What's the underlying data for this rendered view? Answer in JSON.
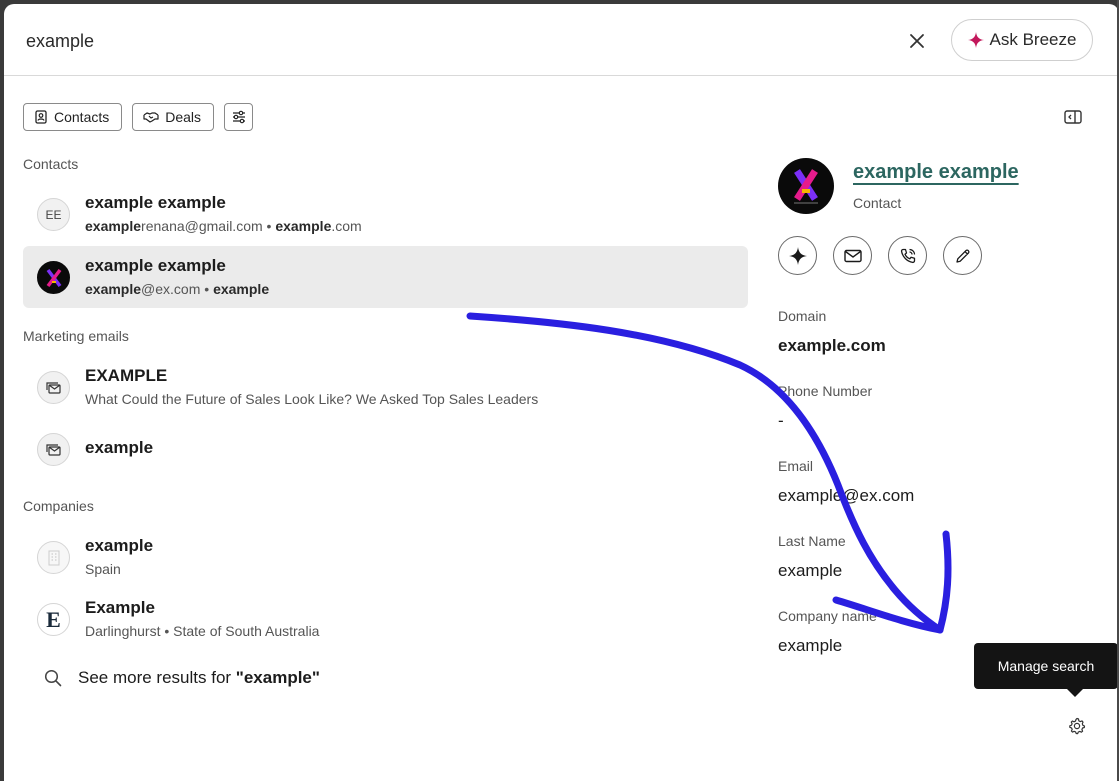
{
  "search": {
    "value": "example"
  },
  "header": {
    "ask_label": "Ask Breeze",
    "accent": "#c2185b"
  },
  "filters": [
    {
      "label": "Contacts",
      "icon": "contacts-icon"
    },
    {
      "label": "Deals",
      "icon": "handshake-icon"
    }
  ],
  "sections": {
    "contacts": "Contacts",
    "marketing": "Marketing emails",
    "companies": "Companies"
  },
  "contacts": [
    {
      "avatar": "EE",
      "name": "example example",
      "sub_bold1": "example",
      "sub_rest1": "renana@gmail.com • ",
      "sub_bold2": "example",
      "sub_rest2": ".com"
    },
    {
      "name": "example example",
      "sub_bold1": "example",
      "sub_rest1": "@ex.com • ",
      "sub_bold2": "example",
      "sub_rest2": ""
    }
  ],
  "marketing_emails": [
    {
      "title": "EXAMPLE",
      "sub": "What Could the Future of Sales Look Like? We Asked Top Sales Leaders"
    },
    {
      "title": "example"
    }
  ],
  "companies": [
    {
      "name": "example",
      "sub": "Spain"
    },
    {
      "name": "Example",
      "sub": "Darlinghurst • State of South Australia",
      "logo_letter": "E"
    }
  ],
  "see_more": {
    "prefix": "See more results for ",
    "query": "\"example\""
  },
  "preview": {
    "name": "example example",
    "type": "Contact",
    "name_color": "#2c6660",
    "fields": [
      {
        "label": "Domain",
        "value": "example.com"
      },
      {
        "label": "Phone Number",
        "value": "-"
      },
      {
        "label": "Email",
        "value": "example@ex.com"
      },
      {
        "label": "Last Name",
        "value": "example"
      },
      {
        "label": "Company name",
        "value": "example"
      }
    ]
  },
  "tooltip": {
    "text": "Manage search"
  },
  "annotation": {
    "color": "#2a1fe0"
  }
}
